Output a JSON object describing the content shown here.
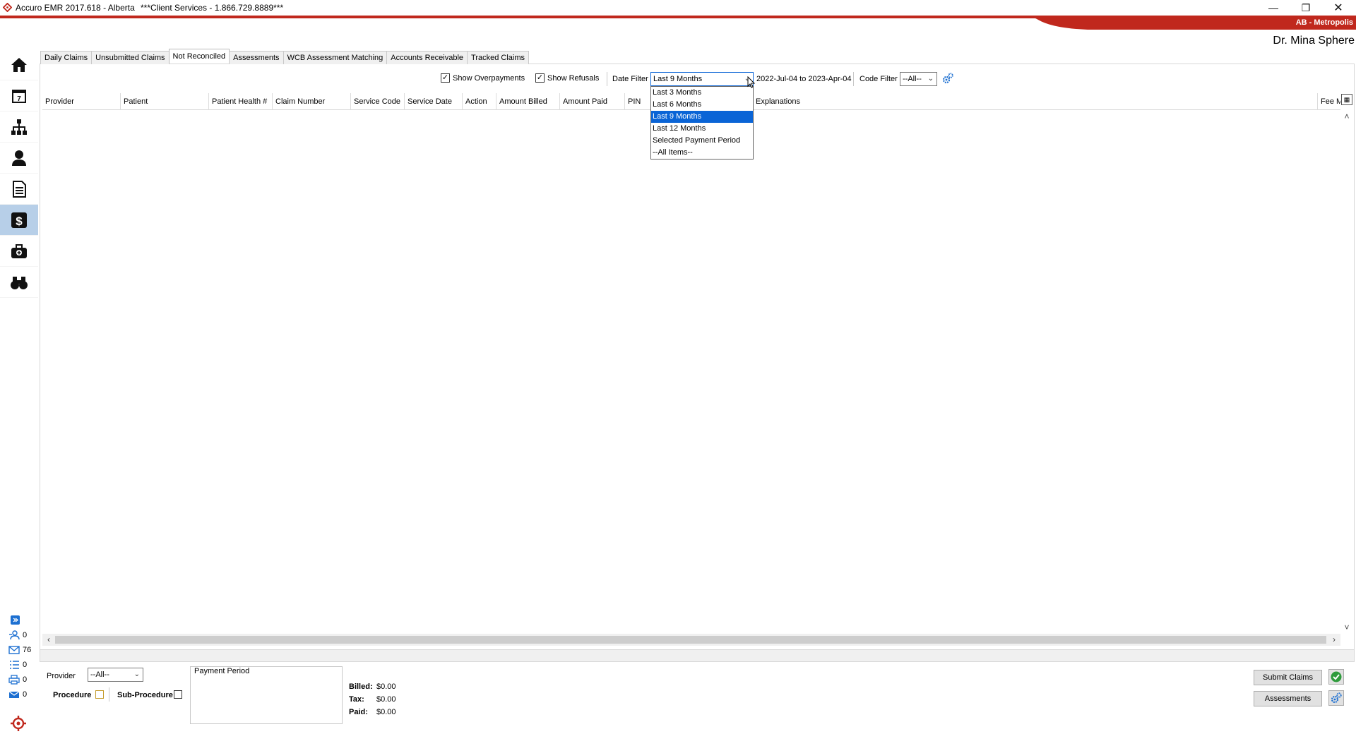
{
  "window": {
    "title": "Accuro EMR 2017.618 - Alberta",
    "services": "***Client Services - 1.866.729.8889***",
    "region": "AB - Metropolis",
    "doctor": "Dr. Mina Sphere",
    "brand_color": "#c0281d"
  },
  "tabs": [
    {
      "label": "Daily Claims"
    },
    {
      "label": "Unsubmitted Claims"
    },
    {
      "label": "Not Reconciled",
      "active": true
    },
    {
      "label": "Assessments"
    },
    {
      "label": "WCB Assessment Matching"
    },
    {
      "label": "Accounts Receivable"
    },
    {
      "label": "Tracked Claims"
    }
  ],
  "toolbar": {
    "show_overpayments": "Show Overpayments",
    "show_refusals": "Show Refusals",
    "date_filter_label": "Date Filter",
    "date_filter_value": "Last 9 Months",
    "date_range": "2022-Jul-04 to 2023-Apr-04",
    "code_filter_label": "Code Filter",
    "code_filter_value": "--All--"
  },
  "date_filter_options": [
    "Last 3 Months",
    "Last 6 Months",
    "Last 9 Months",
    "Last 12 Months",
    "Selected Payment Period",
    "--All Items--"
  ],
  "columns": [
    "Provider",
    "Patient",
    "Patient Health #",
    "Claim Number",
    "Service Code",
    "Service Date",
    "Action",
    "Amount Billed",
    "Amount Paid",
    "PIN",
    "Explanations",
    "Fee M"
  ],
  "status_counts": {
    "users": "0",
    "messages": "76",
    "tasks": "0",
    "print": "0",
    "inbox": "0"
  },
  "bottom": {
    "provider_label": "Provider",
    "provider_value": "--All--",
    "procedure_label": "Procedure",
    "sub_procedure_label": "Sub-Procedure",
    "payment_period_label": "Payment Period",
    "billed_label": "Billed:",
    "billed_value": "$0.00",
    "tax_label": "Tax:",
    "tax_value": "$0.00",
    "paid_label": "Paid:",
    "paid_value": "$0.00",
    "submit_claims": "Submit Claims",
    "assessments": "Assessments"
  }
}
